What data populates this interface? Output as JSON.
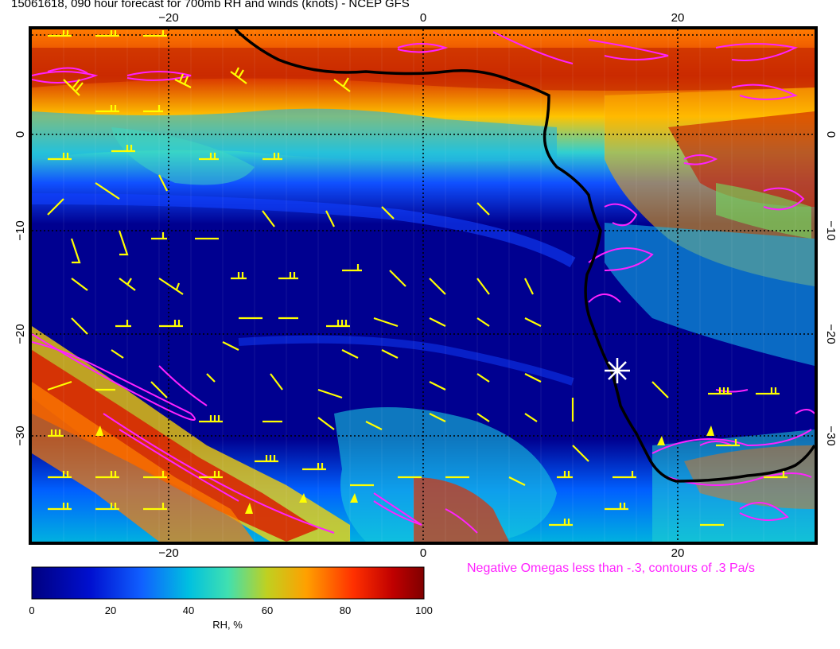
{
  "title": "15061618, 090 hour forecast for 700mb RH and winds (knots) - NCEP GFS",
  "axes": {
    "x_ticks": [
      "−20",
      "0",
      "20"
    ],
    "y_ticks": [
      "0",
      "−10",
      "−20",
      "−30"
    ]
  },
  "omega_note": "Negative Omegas less than -.3, contours of .3 Pa/s",
  "colorbar": {
    "label": "RH, %",
    "ticks": [
      "0",
      "20",
      "40",
      "60",
      "80",
      "100"
    ],
    "colors": [
      "#000080",
      "#0010d0",
      "#1060ff",
      "#00c0e0",
      "#40e0c0",
      "#c0d020",
      "#ffa000",
      "#ff4000",
      "#c00000",
      "#800000"
    ]
  },
  "colors": {
    "coastline": "#000000",
    "wind_barbs": "#ffff00",
    "omega_contours": "#ff22ff",
    "marker": "#ffffff"
  }
}
